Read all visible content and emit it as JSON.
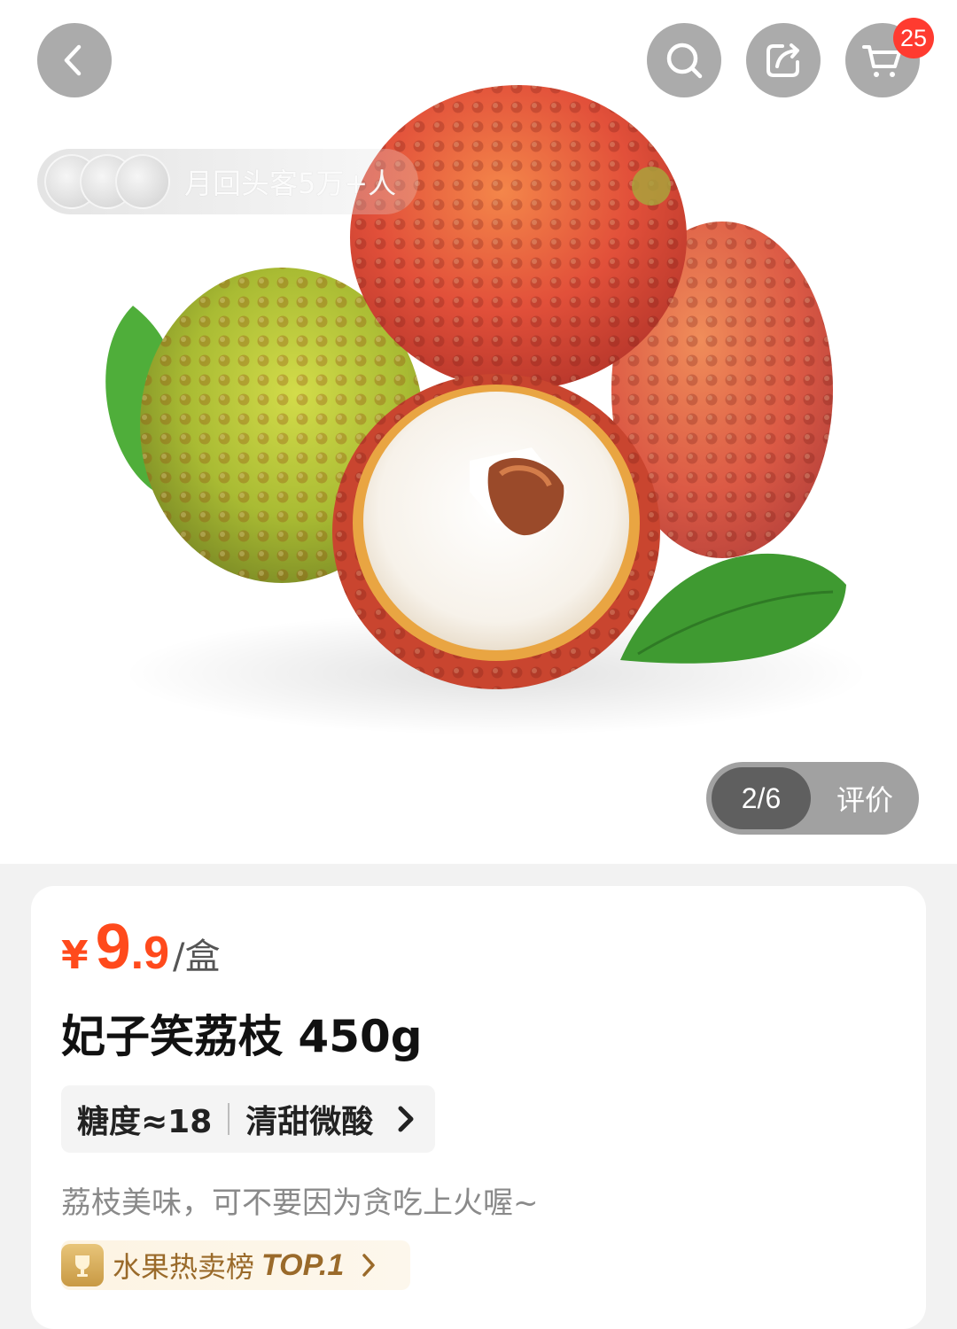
{
  "header": {
    "cart_badge": "25"
  },
  "hero": {
    "repeat_customers": "月回头客5万+人",
    "gallery_count": "2/6",
    "gallery_review": "评价"
  },
  "product": {
    "currency": "¥",
    "price_integer": "9",
    "price_decimal": ".9",
    "price_unit": "/盒",
    "title": "妃子笑荔枝 450g",
    "sweetness": "糖度≈18",
    "taste": "清甜微酸",
    "tagline": "荔枝美味，可不要因为贪吃上火喔~",
    "rank_label": "水果热卖榜",
    "rank_top": "TOP.1"
  },
  "colors": {
    "price_accent": "#ff4a1c",
    "badge": "#ff3b30",
    "rank_text": "#9a6a2a"
  },
  "icons": [
    "back-arrow-icon",
    "search-icon",
    "share-icon",
    "cart-icon",
    "chevron-right-icon",
    "trophy-icon"
  ]
}
